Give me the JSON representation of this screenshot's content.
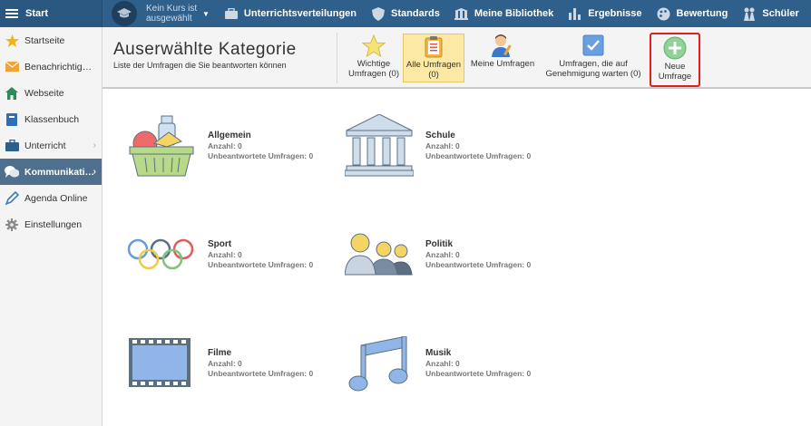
{
  "topbar": {
    "start_label": "Start",
    "course_text": "Kein Kurs ist ausgewählt",
    "links": [
      {
        "label": "Unterrichtsverteilungen",
        "icon": "briefcase-icon"
      },
      {
        "label": "Standards",
        "icon": "shield-icon"
      },
      {
        "label": "Meine Bibliothek",
        "icon": "library-icon"
      },
      {
        "label": "Ergebnisse",
        "icon": "bar-chart-icon"
      },
      {
        "label": "Bewertung",
        "icon": "palette-icon"
      },
      {
        "label": "Schüler",
        "icon": "students-icon"
      }
    ]
  },
  "sidebar": {
    "items": [
      {
        "label": "Startseite",
        "icon": "star-icon"
      },
      {
        "label": "Benachrichtigungen",
        "icon": "envelope-icon"
      },
      {
        "label": "Webseite",
        "icon": "house-icon"
      },
      {
        "label": "Klassenbuch",
        "icon": "book-icon"
      },
      {
        "label": "Unterricht",
        "icon": "briefcase-icon"
      },
      {
        "label": "Kommunikation",
        "icon": "chat-icon"
      },
      {
        "label": "Agenda Online",
        "icon": "pencil-icon"
      },
      {
        "label": "Einstellungen",
        "icon": "gear-icon"
      }
    ]
  },
  "header": {
    "title": "Auserwählte Kategorie",
    "subtitle": "Liste der Umfragen die Sie beantworten können"
  },
  "toolbar": {
    "important": "Wichtige Umfragen (0)",
    "all": "Alle Umfragen (0)",
    "mine": "Meine Umfragen",
    "pending": "Umfragen, die auf Genehmigung warten (0)",
    "new": "Neue Umfrage"
  },
  "categories": [
    {
      "name": "Allgemein",
      "count": "Anzahl: 0",
      "unanswered": "Unbeantwortete Umfragen: 0"
    },
    {
      "name": "Schule",
      "count": "Anzahl: 0",
      "unanswered": "Unbeantwortete Umfragen: 0"
    },
    {
      "name": "Sport",
      "count": "Anzahl: 0",
      "unanswered": "Unbeantwortete Umfragen: 0"
    },
    {
      "name": "Politik",
      "count": "Anzahl: 0",
      "unanswered": "Unbeantwortete Umfragen: 0"
    },
    {
      "name": "Filme",
      "count": "Anzahl: 0",
      "unanswered": "Unbeantwortete Umfragen: 0"
    },
    {
      "name": "Musik",
      "count": "Anzahl: 0",
      "unanswered": "Unbeantwortete Umfragen: 0"
    }
  ],
  "colors": {
    "topbar": "#2f5f8b",
    "sidebar_active": "#4e6f8e",
    "highlight_border": "#e01f1f",
    "selected_tab": "#fde9a6"
  }
}
